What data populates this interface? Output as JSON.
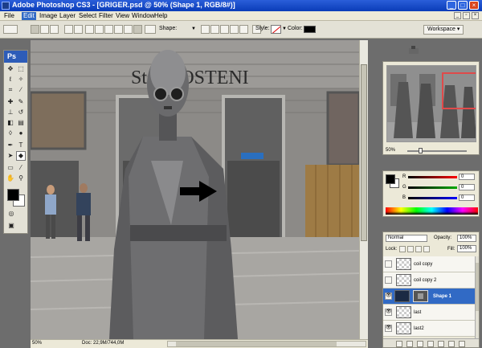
{
  "window": {
    "title": "Adobe Photoshop CS3 - [GRIGER.psd @ 50% (Shape 1, RGB/8#)]"
  },
  "menubar": {
    "items": [
      "File",
      "Edit",
      "Image",
      "Layer",
      "Select",
      "Filter",
      "View",
      "Window",
      "Help"
    ],
    "active": "Edit"
  },
  "options": {
    "shape_label": "Shape:",
    "style_label": "Style:",
    "color_label": "Color:",
    "color_value": "#000000",
    "workspace_label": "Workspace ▾"
  },
  "toolbox": {
    "logo": "Ps"
  },
  "image": {
    "sign_text": "St    n  OOSTENI",
    "arrow_color": "#000000"
  },
  "document_status": {
    "zoom": "50%",
    "doc_size": "Doc: 22,9M/744,0M"
  },
  "navigator": {
    "zoom": "50%",
    "zoom_slider_fraction": 0.2
  },
  "color_panel": {
    "r_label": "R",
    "g_label": "G",
    "b_label": "B",
    "r_value": "0",
    "g_value": "0",
    "b_value": "0",
    "foreground": "#000000",
    "background": "#ffffff"
  },
  "layers_panel": {
    "blend_mode": "Normal",
    "opacity_label": "Opacity:",
    "opacity_value": "100%",
    "lock_label": "Lock:",
    "fill_label": "Fill:",
    "fill_value": "100%",
    "layers": [
      {
        "name": "coil copy",
        "visible": false,
        "selected": false
      },
      {
        "name": "coil copy 2",
        "visible": false,
        "selected": false
      },
      {
        "name": "Shape 1",
        "visible": true,
        "selected": true
      },
      {
        "name": "last",
        "visible": true,
        "selected": false
      },
      {
        "name": "last2",
        "visible": true,
        "selected": false
      }
    ]
  }
}
